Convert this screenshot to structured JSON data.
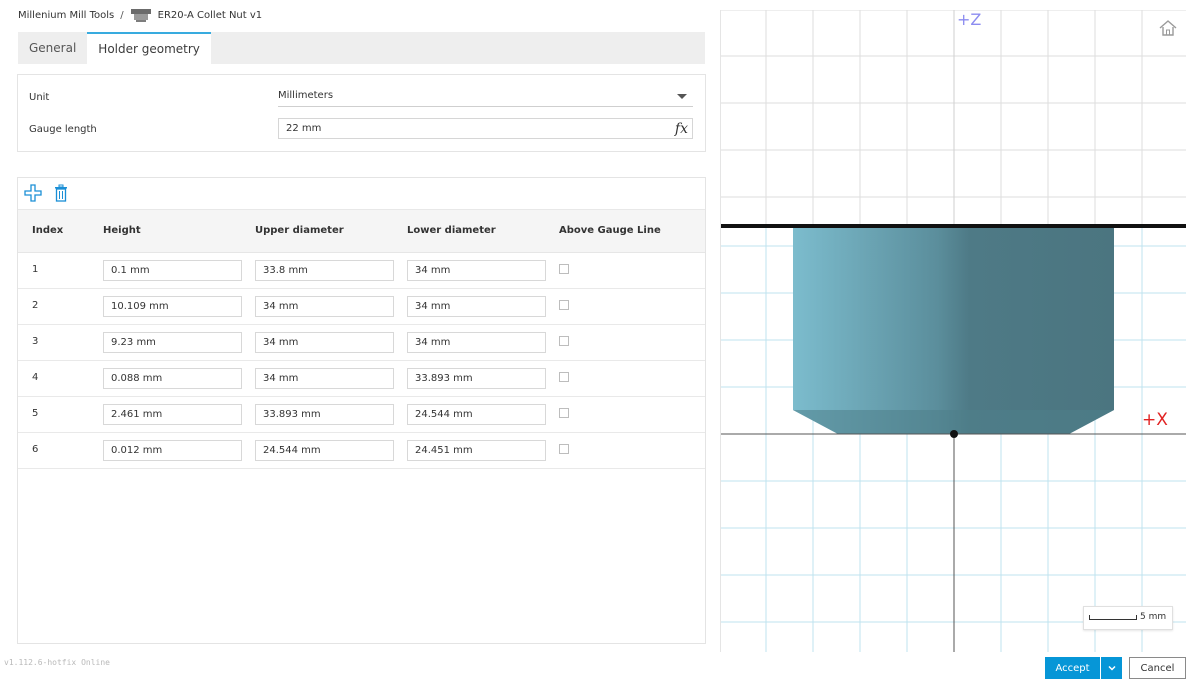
{
  "breadcrumb": {
    "root": "Millenium Mill Tools",
    "separator": "/",
    "item_icon": "collet-nut-icon",
    "current": "ER20-A Collet Nut v1"
  },
  "tabs": [
    {
      "label": "General"
    },
    {
      "label": "Holder geometry",
      "active": true
    }
  ],
  "settings": {
    "unit_label": "Unit",
    "unit_value": "Millimeters",
    "gauge_label": "Gauge length",
    "gauge_value": "22 mm",
    "fx_label": "fx"
  },
  "table": {
    "add_icon": "add-row-icon",
    "delete_icon": "trash-icon",
    "columns": [
      "Index",
      "Height",
      "Upper diameter",
      "Lower diameter",
      "Above Gauge Line"
    ],
    "rows": [
      {
        "index": "1",
        "height": "0.1 mm",
        "upper": "33.8 mm",
        "lower": "34 mm",
        "above": false
      },
      {
        "index": "2",
        "height": "10.109 mm",
        "upper": "34 mm",
        "lower": "34 mm",
        "above": false
      },
      {
        "index": "3",
        "height": "9.23 mm",
        "upper": "34 mm",
        "lower": "34 mm",
        "above": false
      },
      {
        "index": "4",
        "height": "0.088 mm",
        "upper": "34 mm",
        "lower": "33.893 mm",
        "above": false
      },
      {
        "index": "5",
        "height": "2.461 mm",
        "upper": "33.893 mm",
        "lower": "24.544 mm",
        "above": false
      },
      {
        "index": "6",
        "height": "0.012 mm",
        "upper": "24.544 mm",
        "lower": "24.451 mm",
        "above": false
      }
    ]
  },
  "version": "v1.112.6-hotfix Online",
  "viewport": {
    "z_axis_label": "+Z",
    "x_axis_label": "+X",
    "home_icon": "home-icon",
    "scale_label": "5 mm",
    "grid_color": "#bfe3ef",
    "holder_color": "#5e8a96"
  },
  "footer": {
    "accept_label": "Accept",
    "cancel_label": "Cancel",
    "accent": "#0696d7"
  }
}
